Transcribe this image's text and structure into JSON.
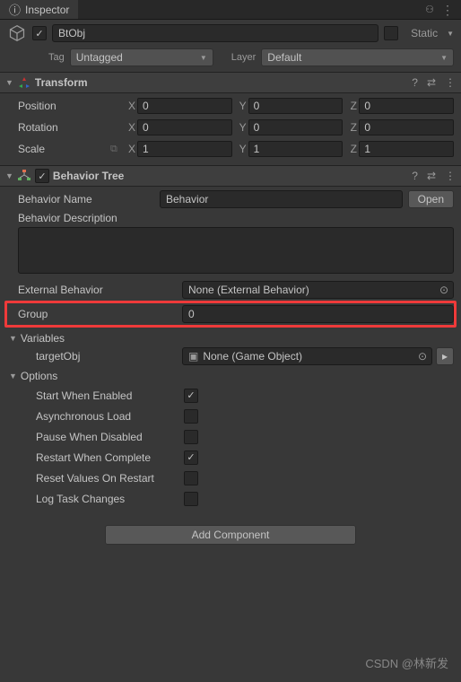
{
  "tab": {
    "title": "Inspector"
  },
  "gameObject": {
    "name": "BtObj",
    "enabled": true,
    "static_label": "Static",
    "tag_label": "Tag",
    "tag_value": "Untagged",
    "layer_label": "Layer",
    "layer_value": "Default"
  },
  "transform": {
    "title": "Transform",
    "position_label": "Position",
    "rotation_label": "Rotation",
    "scale_label": "Scale",
    "axes": {
      "x": "X",
      "y": "Y",
      "z": "Z"
    },
    "position": {
      "x": "0",
      "y": "0",
      "z": "0"
    },
    "rotation": {
      "x": "0",
      "y": "0",
      "z": "0"
    },
    "scale": {
      "x": "1",
      "y": "1",
      "z": "1"
    }
  },
  "behaviorTree": {
    "title": "Behavior Tree",
    "enabled": true,
    "name_label": "Behavior Name",
    "name_value": "Behavior",
    "open_label": "Open",
    "desc_label": "Behavior Description",
    "desc_value": "",
    "external_label": "External Behavior",
    "external_value": "None (External Behavior)",
    "group_label": "Group",
    "group_value": "0",
    "variables_label": "Variables",
    "variables": [
      {
        "name": "targetObj",
        "value": "None (Game Object)"
      }
    ],
    "options_label": "Options",
    "options": [
      {
        "label": "Start When Enabled",
        "checked": true
      },
      {
        "label": "Asynchronous Load",
        "checked": false
      },
      {
        "label": "Pause When Disabled",
        "checked": false
      },
      {
        "label": "Restart When Complete",
        "checked": true
      },
      {
        "label": "Reset Values On Restart",
        "checked": false
      },
      {
        "label": "Log Task Changes",
        "checked": false
      }
    ]
  },
  "addComponent": "Add Component",
  "watermark": "CSDN @林新发"
}
